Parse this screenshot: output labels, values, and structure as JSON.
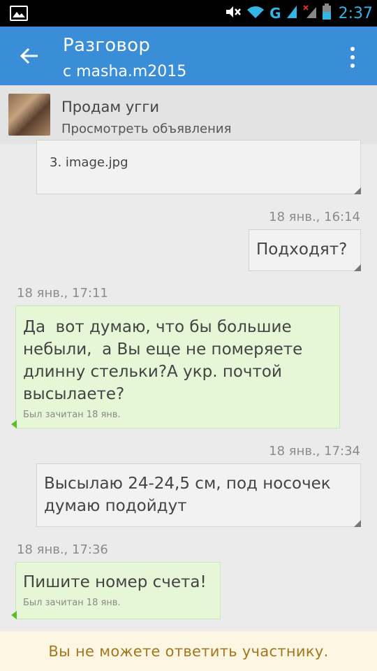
{
  "status_bar": {
    "time": "2:37",
    "network_label": "G",
    "icons": [
      "image-icon",
      "mute-icon",
      "wifi-icon",
      "signal-icon",
      "signal-x-icon",
      "battery-icon"
    ],
    "accent_color": "#33b5e5"
  },
  "app_bar": {
    "title": "Разговор",
    "subtitle": "с masha.m2015",
    "color": "#3a8ed8"
  },
  "listing": {
    "title": "Продам угги",
    "action": "Просмотреть объявления"
  },
  "messages": [
    {
      "side": "out",
      "text": "3. image.jpg"
    },
    {
      "side": "out",
      "timestamp": "18  янв., 16:14",
      "text": "Подходят?"
    },
    {
      "side": "in",
      "timestamp": "18  янв., 17:11",
      "text": "Да  вот думаю, что бы большие небыли,  а Вы еще не померяете длинну стельки?А укр. почтой высылаете?",
      "read_status": "Был зачитан 18  янв."
    },
    {
      "side": "out",
      "timestamp": "18  янв., 17:34",
      "text": "Высылаю 24-24,5 см, под носочек думаю подойдут"
    },
    {
      "side": "in",
      "timestamp": "18  янв., 17:36",
      "text": "Пишите номер счета!",
      "read_status": "Был зачитан 18  янв."
    }
  ],
  "footer": {
    "notice": "Вы не можете ответить участнику.",
    "color": "#a3761f"
  }
}
